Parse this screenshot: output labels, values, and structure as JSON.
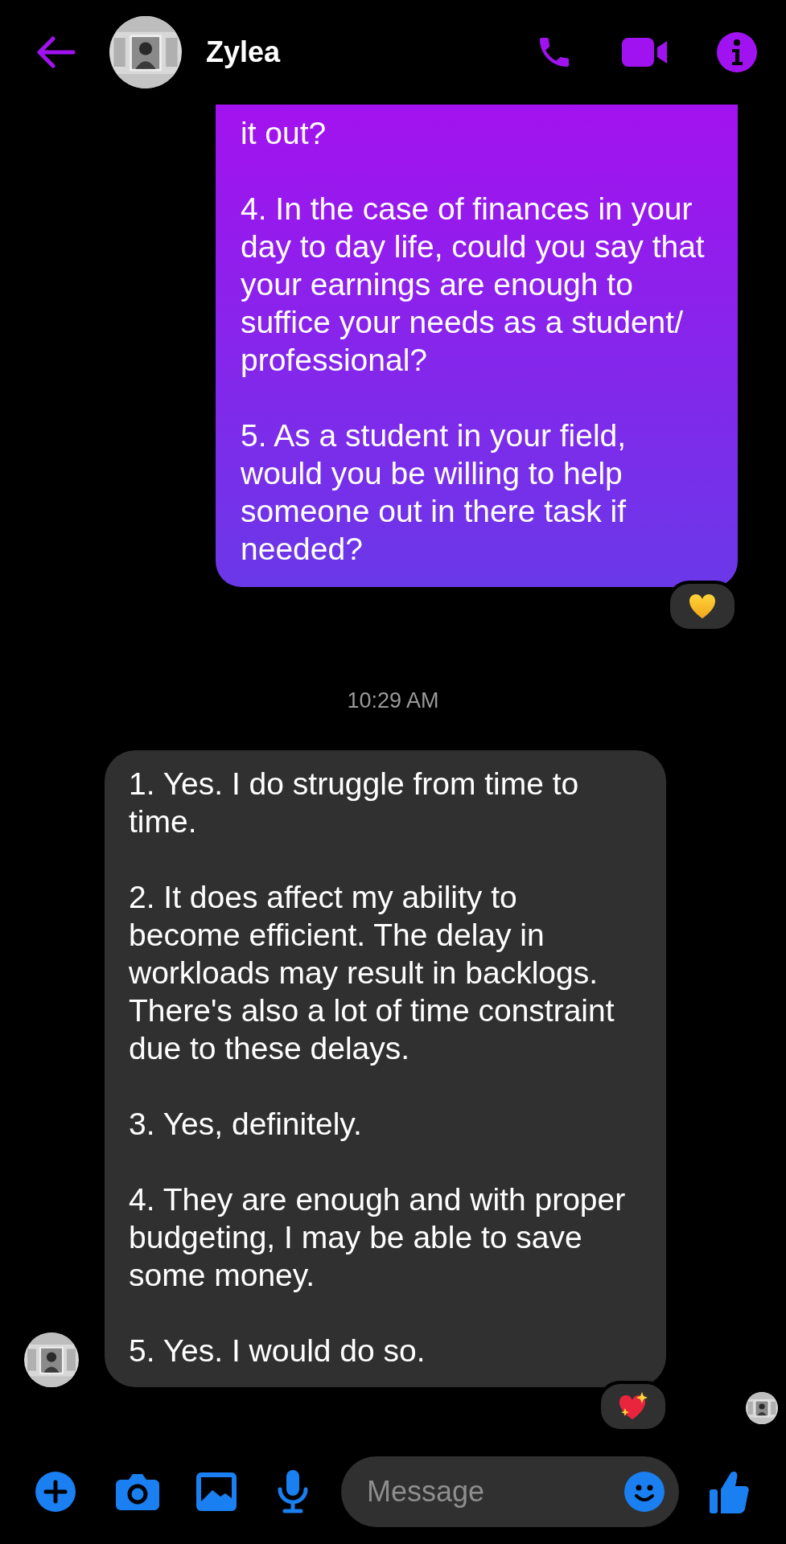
{
  "header": {
    "title": "Zylea"
  },
  "thread": [
    {
      "kind": "outgoing",
      "paragraphs": [
        "it out?",
        "4. In the case of finances in your day to day life, could you say that your earnings are enough to suffice your needs as a student/ professional?",
        "5. As a student in your field, would you be willing to help someone out in there task if needed?"
      ],
      "reaction": {
        "kind": "yellow-heart"
      }
    },
    {
      "kind": "time",
      "text": "10:29 AM"
    },
    {
      "kind": "incoming",
      "paragraphs": [
        "1. Yes. I do struggle from time to time.",
        "2. It does affect my ability to become efficient. The delay in workloads may result in backlogs. There's also a lot of time constraint due to these delays.",
        "3. Yes, definitely.",
        "4. They are enough and with proper budgeting, I may be able to save some money.",
        "5. Yes. I would do so."
      ],
      "reaction": {
        "kind": "sparkling-heart"
      },
      "seen": true
    }
  ],
  "composer": {
    "placeholder": "Message"
  }
}
